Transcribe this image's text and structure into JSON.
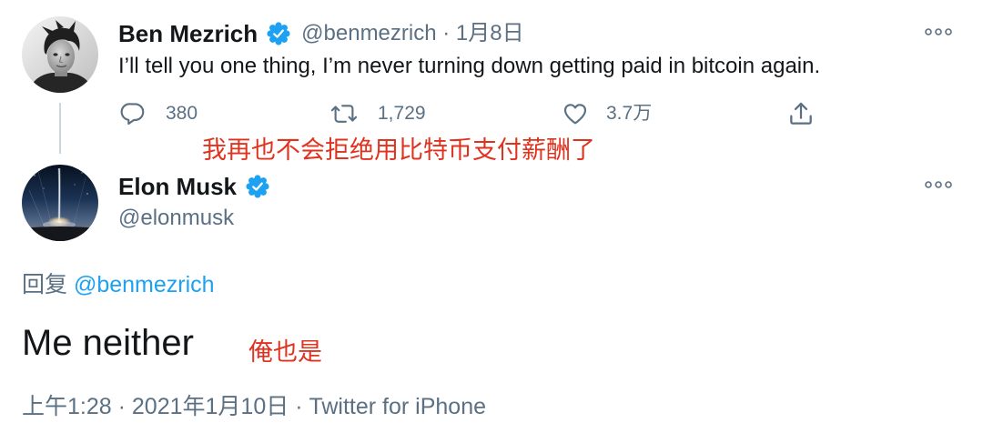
{
  "colors": {
    "text": "#14171a",
    "muted": "#5b7083",
    "accent": "#1da1f2",
    "annotation": "#e0331f",
    "thread_line": "#ccd6dd"
  },
  "parent_tweet": {
    "author": {
      "name": "Ben Mezrich",
      "handle": "@benmezrich",
      "verified": true
    },
    "separator": "·",
    "date": "1月8日",
    "text": "I’ll tell you one thing, I’m never turning down getting paid in bitcoin again.",
    "more_icon": "more-icon",
    "actions": {
      "reply": {
        "icon": "reply-icon",
        "count": "380"
      },
      "retweet": {
        "icon": "retweet-icon",
        "count": "1,729"
      },
      "like": {
        "icon": "like-icon",
        "count": "3.7万"
      },
      "share": {
        "icon": "share-icon"
      }
    }
  },
  "annotations": {
    "parent_translation": "我再也不会拒绝用比特币支付薪酬了",
    "reply_translation": "俺也是"
  },
  "reply_tweet": {
    "author": {
      "name": "Elon Musk",
      "handle": "@elonmusk",
      "verified": true
    },
    "more_icon": "more-icon",
    "replying_to": {
      "prefix": "回复",
      "handle": "@benmezrich"
    },
    "text": "Me neither",
    "meta": {
      "time": "上午1:28",
      "separator": "·",
      "date": "2021年1月10日",
      "source": "Twitter for iPhone"
    }
  }
}
